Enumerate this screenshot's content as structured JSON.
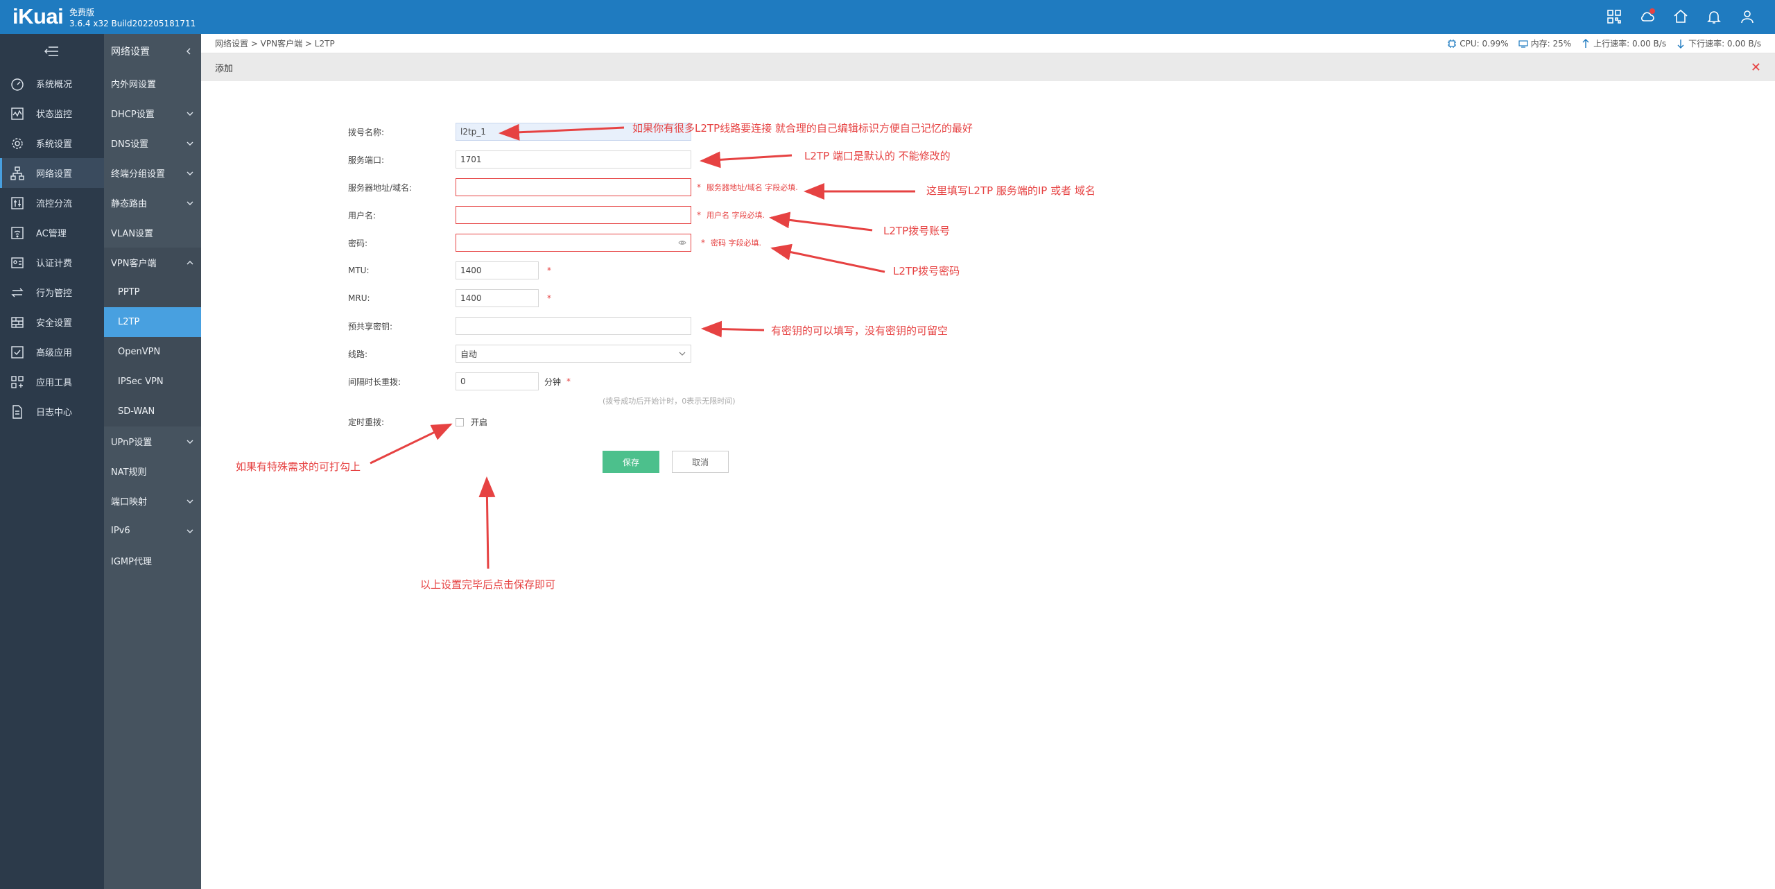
{
  "header": {
    "logo": "iKuai",
    "edition": "免费版",
    "version": "3.6.4 x32 Build202205181711",
    "icons": [
      "grid-icon",
      "cloud-icon",
      "home-icon",
      "bell-icon",
      "user-icon"
    ]
  },
  "nav_primary": [
    {
      "label": "系统概况",
      "icon": "dashboard-icon"
    },
    {
      "label": "状态监控",
      "icon": "monitor-icon"
    },
    {
      "label": "系统设置",
      "icon": "gear-icon"
    },
    {
      "label": "网络设置",
      "icon": "network-icon",
      "active": true
    },
    {
      "label": "流控分流",
      "icon": "sliders-icon"
    },
    {
      "label": "AC管理",
      "icon": "wifi-icon"
    },
    {
      "label": "认证计费",
      "icon": "id-card-icon"
    },
    {
      "label": "行为管控",
      "icon": "exchange-icon"
    },
    {
      "label": "安全设置",
      "icon": "firewall-icon"
    },
    {
      "label": "高级应用",
      "icon": "check-box-icon"
    },
    {
      "label": "应用工具",
      "icon": "apps-icon"
    },
    {
      "label": "日志中心",
      "icon": "document-icon"
    }
  ],
  "nav_secondary": {
    "title": "网络设置",
    "items": [
      {
        "label": "内外网设置",
        "expandable": false
      },
      {
        "label": "DHCP设置",
        "expandable": true
      },
      {
        "label": "DNS设置",
        "expandable": true
      },
      {
        "label": "终端分组设置",
        "expandable": true
      },
      {
        "label": "静态路由",
        "expandable": true
      },
      {
        "label": "VLAN设置",
        "expandable": false
      },
      {
        "label": "VPN客户端",
        "expandable": true,
        "open": true
      }
    ],
    "vpn_sub": [
      "PPTP",
      "L2TP",
      "OpenVPN",
      "IPSec VPN",
      "SD-WAN"
    ],
    "items_after": [
      {
        "label": "UPnP设置",
        "expandable": true
      },
      {
        "label": "NAT规则",
        "expandable": false
      },
      {
        "label": "端口映射",
        "expandable": true
      },
      {
        "label": "IPv6",
        "expandable": true
      },
      {
        "label": "IGMP代理",
        "expandable": false
      }
    ]
  },
  "breadcrumb": "网络设置 > VPN客户端 > L2TP",
  "status": {
    "cpu": "CPU: 0.99%",
    "mem": "内存: 25%",
    "up": "上行速率: 0.00 B/s",
    "down": "下行速率: 0.00 B/s"
  },
  "panel_title": "添加",
  "form": {
    "name_label": "拨号名称:",
    "name_value": "l2tp_1",
    "port_label": "服务端口:",
    "port_value": "1701",
    "server_label": "服务器地址/域名:",
    "server_error": "服务器地址/域名 字段必填.",
    "user_label": "用户名:",
    "user_error": "用户名 字段必填.",
    "pass_label": "密码:",
    "pass_error": "密码 字段必填.",
    "mtu_label": "MTU:",
    "mtu_value": "1400",
    "mru_label": "MRU:",
    "mru_value": "1400",
    "psk_label": "预共享密钥:",
    "line_label": "线路:",
    "line_value": "自动",
    "interval_label": "间隔时长重拨:",
    "interval_value": "0",
    "interval_unit": "分钟",
    "interval_hint": "(拨号成功后开始计时，0表示无限时间)",
    "timer_label": "定时重拨:",
    "timer_option": "开启",
    "save": "保存",
    "cancel": "取消"
  },
  "annotations": {
    "a1": "如果你有很多L2TP线路要连接 就合理的自己编辑标识方便自己记忆的最好",
    "a2": "L2TP 端口是默认的 不能修改的",
    "a3": "这里填写L2TP 服务端的IP 或者 域名",
    "a4": "L2TP拨号账号",
    "a5": "L2TP拨号密码",
    "a6": "有密钥的可以填写，没有密钥的可留空",
    "a7": "如果有特殊需求的可打勾上",
    "a8": "以上设置完毕后点击保存即可"
  }
}
